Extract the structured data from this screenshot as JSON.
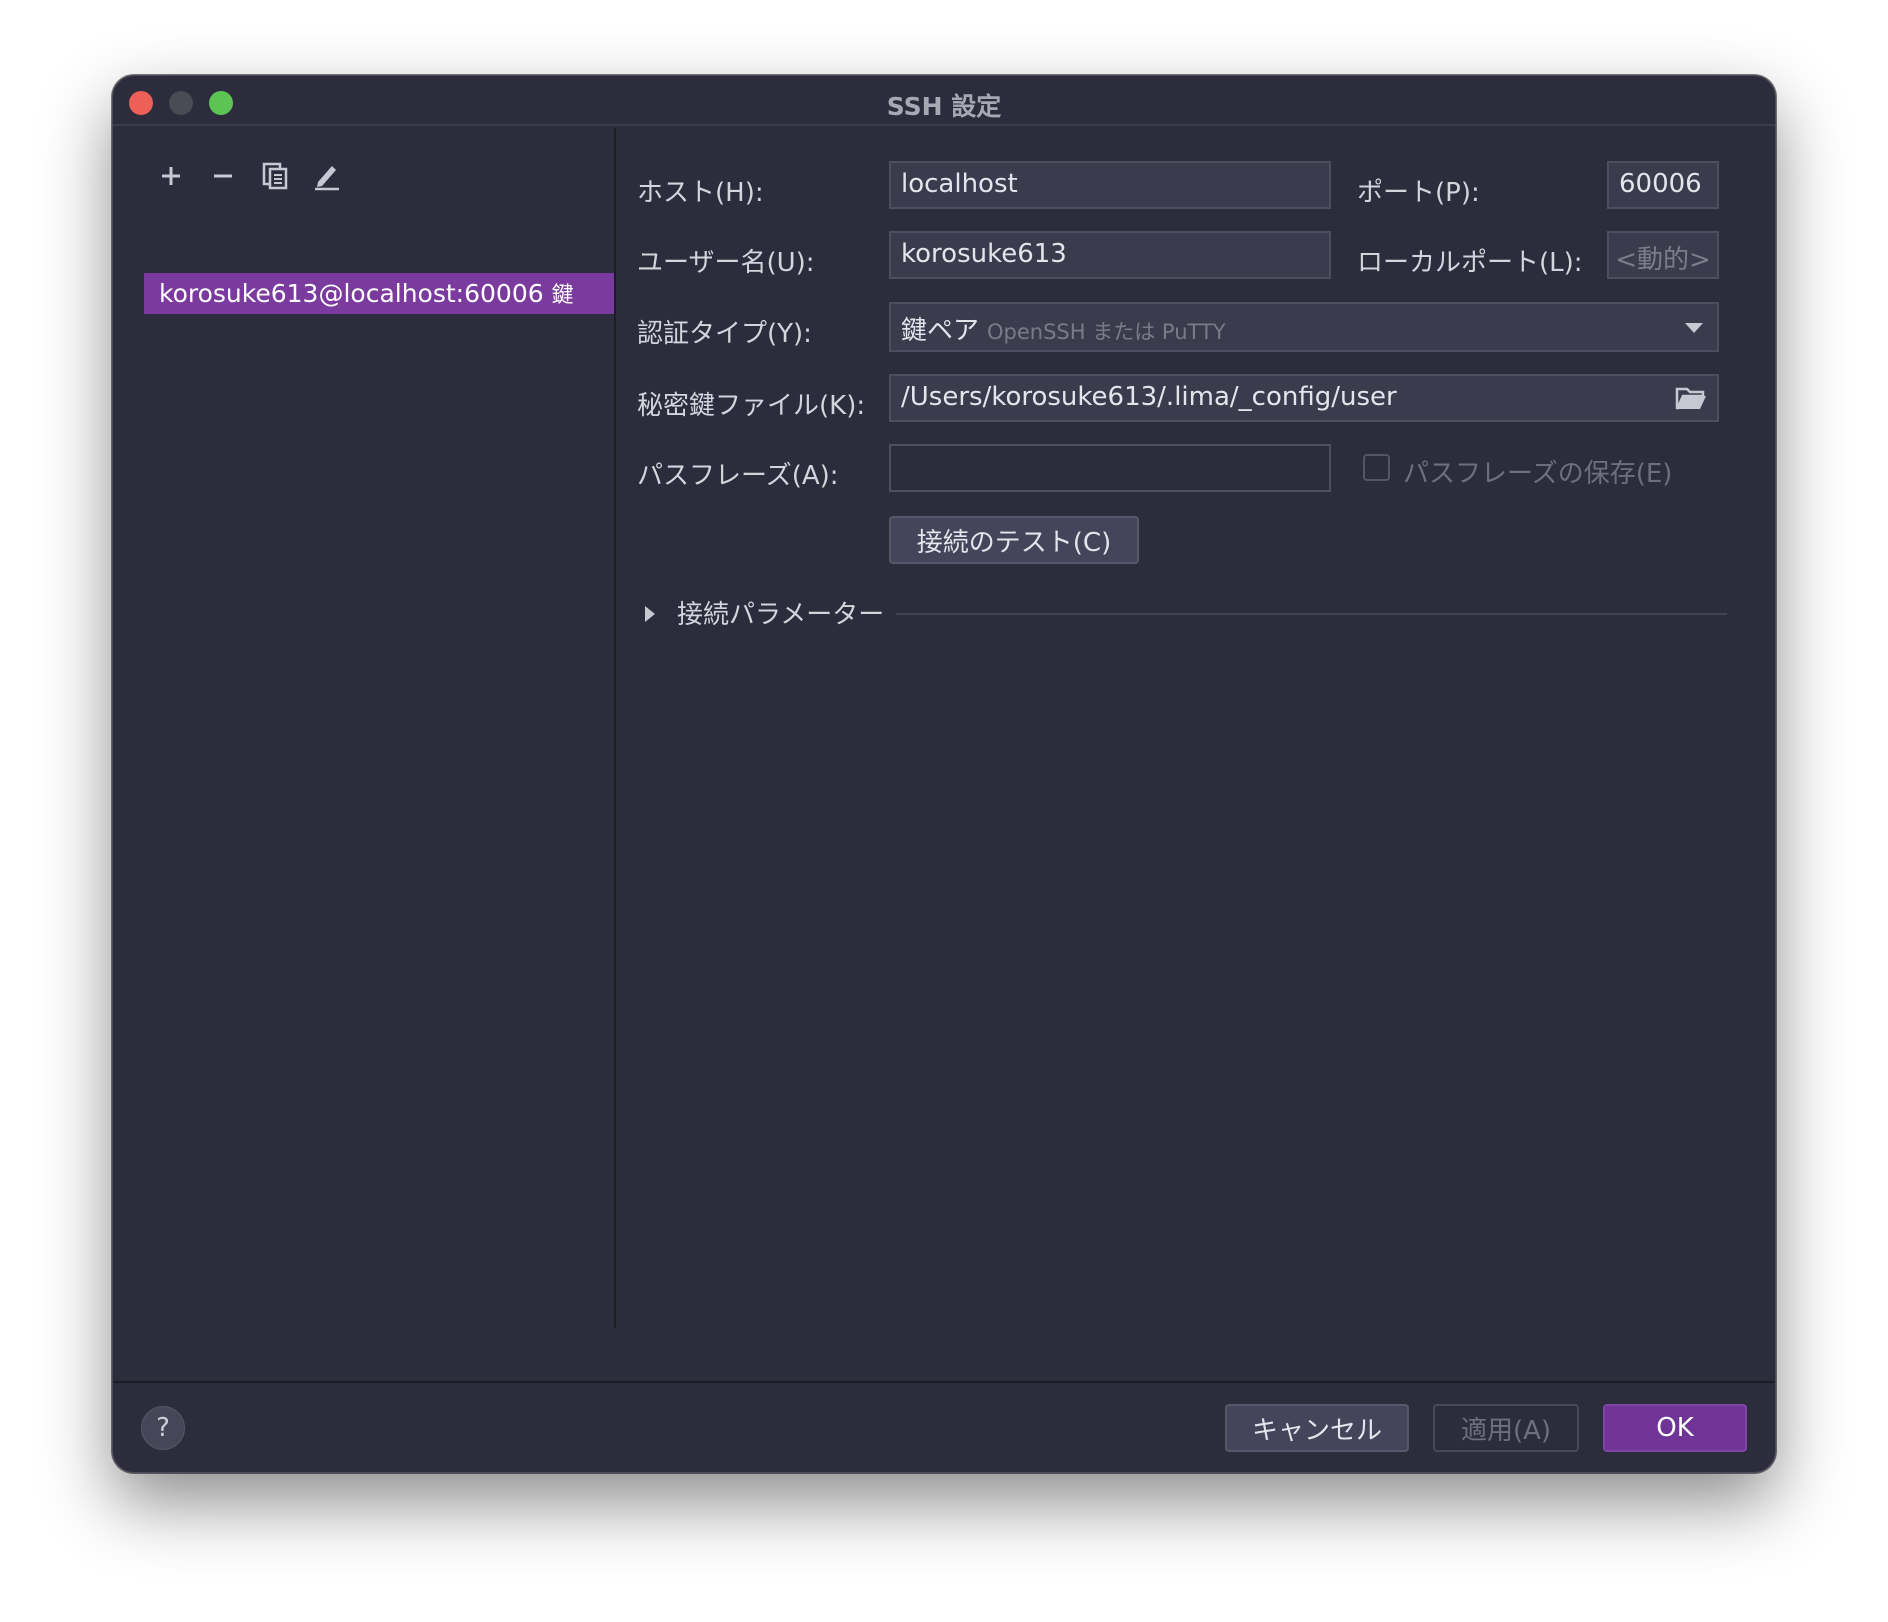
{
  "window": {
    "title": "SSH 設定"
  },
  "toolbar": {
    "add_icon": "plus-icon",
    "remove_icon": "minus-icon",
    "copy_icon": "copy-icon",
    "edit_icon": "pencil-icon"
  },
  "hosts": [
    {
      "label": "korosuke613@localhost:60006",
      "tag": "鍵"
    }
  ],
  "form": {
    "host_label": "ホスト(H):",
    "host_value": "localhost",
    "port_label": "ポート(P):",
    "port_value": "60006",
    "user_label": "ユーザー名(U):",
    "user_value": "korosuke613",
    "local_port_label": "ローカルポート(L):",
    "local_port_placeholder": "<動的>",
    "auth_label": "認証タイプ(Y):",
    "auth_value": "鍵ペア",
    "auth_hint": "OpenSSH または PuTTY",
    "key_label": "秘密鍵ファイル(K):",
    "key_value": "/Users/korosuke613/.lima/_config/user",
    "passphrase_label": "パスフレーズ(A):",
    "passphrase_value": "",
    "save_passphrase_label": "パスフレーズの保存(E)",
    "save_passphrase_checked": false,
    "test_button": "接続のテスト(C)",
    "params_section": "接続パラメーター"
  },
  "footer": {
    "help": "?",
    "cancel": "キャンセル",
    "apply": "適用(A)",
    "ok": "OK"
  },
  "colors": {
    "background": "#2c2c3c",
    "selection": "#7b3b9e",
    "primary_button": "#6f3495",
    "close": "#ee5f57",
    "minimize": "#4b4b55",
    "maximize": "#5cc452"
  }
}
